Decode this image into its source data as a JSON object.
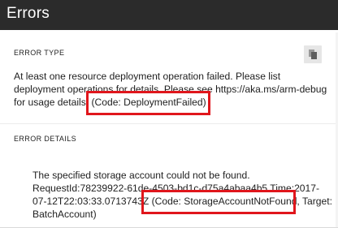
{
  "header": {
    "title": "Errors"
  },
  "error_type": {
    "label": "ERROR TYPE",
    "line1": "At least one resource deployment operation failed. Please list",
    "line2": "deployment operations for details. Please see https://aka.ms/arm-debug",
    "line3_pre": "for usage details.",
    "line3_code": "(Code: DeploymentFailed)",
    "copy_icon": "copy-icon"
  },
  "error_details": {
    "label": "ERROR DETAILS",
    "line1": "The specified storage account could not be found.",
    "line2": "RequestId:78239922-61de-4503-bd1c-d75a4abaa4b5 Time:2017-",
    "line3_pre": "07-12T22:03:33.0713743Z",
    "line3_code": "(Code: StorageAccountNotFound,",
    "line3_post": " Target:",
    "line4": "BatchAccount)"
  },
  "colors": {
    "header_bg": "#2b2b2b",
    "highlight": "#e0161c"
  }
}
